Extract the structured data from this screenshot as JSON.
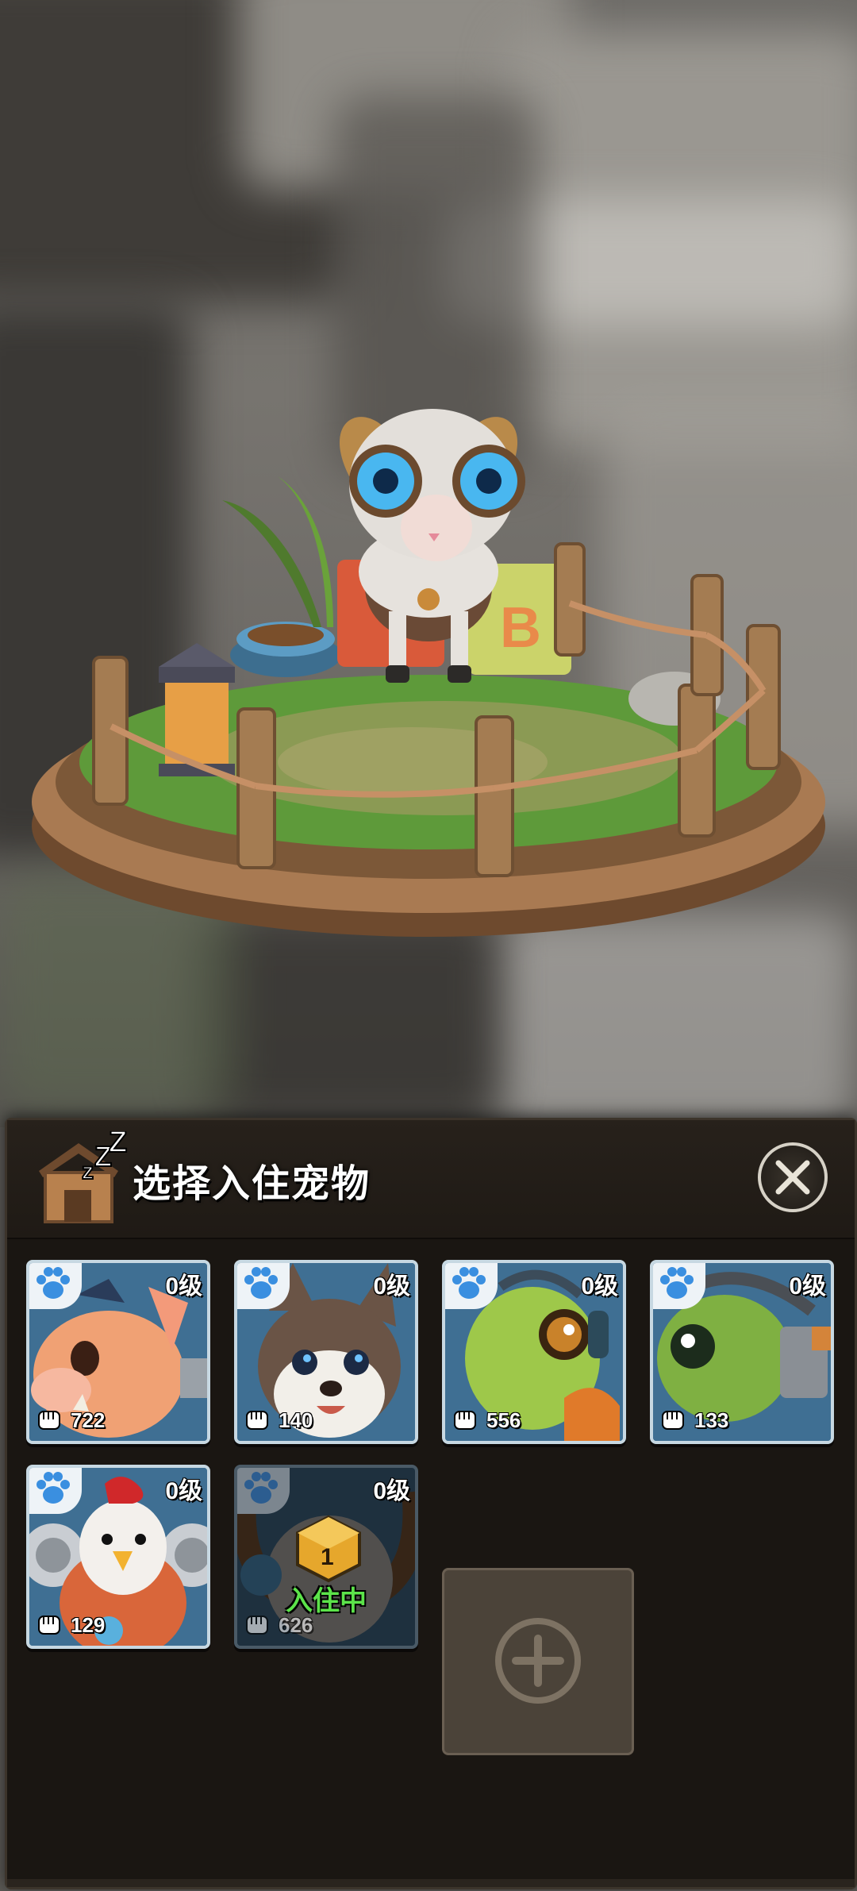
{
  "panel": {
    "title": "选择入住宠物"
  },
  "pets": [
    {
      "name": "boar",
      "level": "0级",
      "power": "722"
    },
    {
      "name": "husky",
      "level": "0级",
      "power": "140"
    },
    {
      "name": "chameleon",
      "level": "0级",
      "power": "556"
    },
    {
      "name": "turtle",
      "level": "0级",
      "power": "133"
    },
    {
      "name": "rooster",
      "level": "0级",
      "power": "129"
    },
    {
      "name": "ram",
      "level": "0级",
      "power": "626",
      "status": "入住中",
      "badge": "1"
    }
  ],
  "colors": {
    "panel_bg": "#1d1915",
    "card_bg": "#3c6f96",
    "resident_text": "#5ce34a",
    "add_slot": "#4b4339"
  },
  "icons": {
    "house": "pet-house-icon",
    "close": "close-icon",
    "paw": "paw-icon",
    "fist": "fist-icon",
    "add": "plus-circle-icon"
  }
}
